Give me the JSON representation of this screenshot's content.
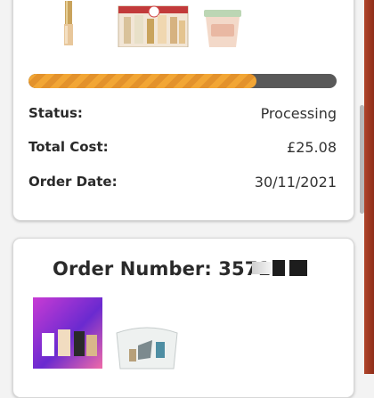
{
  "order1": {
    "progress_fraction": 0.74,
    "status_label": "Status:",
    "status_value": "Processing",
    "total_label": "Total Cost:",
    "total_value": "£25.08",
    "date_label": "Order Date:",
    "date_value": "30/11/2021",
    "products": [
      "mascara-wand-icon",
      "gift-set-icon",
      "cream-jar-icon"
    ]
  },
  "order2": {
    "title": "Order Number: 3571",
    "products": [
      "makeup-palette-icon",
      "cosmetic-bag-icon"
    ]
  },
  "colors": {
    "progress_fill": "#f2a635",
    "progress_track": "#595959",
    "side_accent": "#b0442a"
  }
}
